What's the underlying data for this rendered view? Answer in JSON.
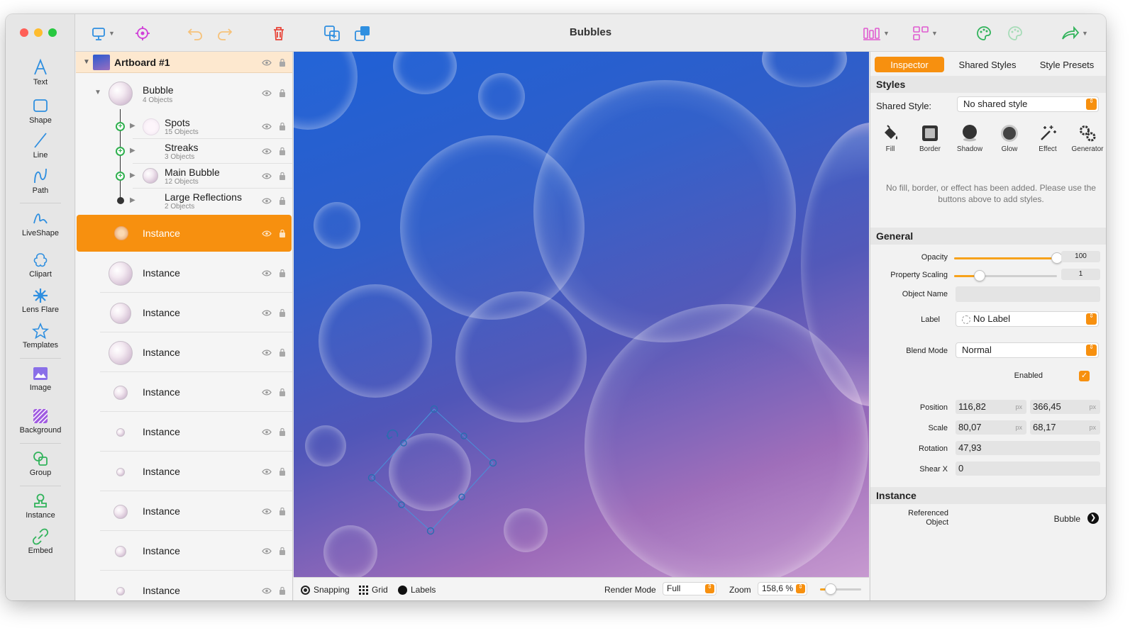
{
  "window": {
    "title": "Bubbles"
  },
  "colors": {
    "accent": "#f7900f",
    "selection": "#4a90d9"
  },
  "tools": [
    {
      "label": "Text",
      "icon": "text-tool-icon"
    },
    {
      "label": "Shape",
      "icon": "shape-tool-icon"
    },
    {
      "label": "Line",
      "icon": "line-tool-icon"
    },
    {
      "label": "Path",
      "icon": "path-tool-icon"
    },
    {
      "label": "LiveShape",
      "icon": "liveshape-tool-icon"
    },
    {
      "label": "Clipart",
      "icon": "clipart-tool-icon"
    },
    {
      "label": "Lens Flare",
      "icon": "lens-flare-tool-icon"
    },
    {
      "label": "Templates",
      "icon": "templates-tool-icon"
    },
    {
      "label": "Image",
      "icon": "image-tool-icon"
    },
    {
      "label": "Background",
      "icon": "background-tool-icon"
    },
    {
      "label": "Group",
      "icon": "group-tool-icon"
    },
    {
      "label": "Instance",
      "icon": "instance-tool-icon"
    },
    {
      "label": "Embed",
      "icon": "embed-tool-icon"
    }
  ],
  "layers": {
    "artboard": "Artboard #1",
    "bubble": {
      "name": "Bubble",
      "count": "4 Objects"
    },
    "children": [
      {
        "name": "Spots",
        "count": "15 Objects"
      },
      {
        "name": "Streaks",
        "count": "3 Objects"
      },
      {
        "name": "Main Bubble",
        "count": "12 Objects"
      },
      {
        "name": "Large Reflections",
        "count": "2 Objects"
      }
    ],
    "instances": [
      "Instance",
      "Instance",
      "Instance",
      "Instance",
      "Instance",
      "Instance",
      "Instance",
      "Instance",
      "Instance",
      "Instance"
    ]
  },
  "status": {
    "snapping": "Snapping",
    "grid": "Grid",
    "labels": "Labels",
    "render_mode_label": "Render Mode",
    "render_mode": "Full",
    "zoom_label": "Zoom",
    "zoom": "158,6 %",
    "zoom_slider_fraction": 0.25
  },
  "inspector": {
    "tabs": [
      "Inspector",
      "Shared Styles",
      "Style Presets"
    ],
    "styles_title": "Styles",
    "shared_style_label": "Shared Style:",
    "shared_style": "No shared style",
    "style_buttons": [
      "Fill",
      "Border",
      "Shadow",
      "Glow",
      "Effect",
      "Generator"
    ],
    "empty_message": "No fill, border, or effect has been added. Please use the buttons above to add styles.",
    "general_title": "General",
    "opacity_label": "Opacity",
    "opacity": "100",
    "opacity_fraction": 1.0,
    "property_scaling_label": "Property Scaling",
    "property_scaling": "1",
    "property_scaling_fraction": 0.25,
    "object_name_label": "Object Name",
    "object_name": "",
    "label_label": "Label",
    "label_value": "No Label",
    "blend_mode_label": "Blend Mode",
    "blend_mode": "Normal",
    "enabled_label": "Enabled",
    "enabled": true,
    "position_label": "Position",
    "position_x": "116,82",
    "position_y": "366,45",
    "scale_label": "Scale",
    "scale_x": "80,07",
    "scale_y": "68,17",
    "unit": "px",
    "rotation_label": "Rotation",
    "rotation": "47,93",
    "shear_label": "Shear X",
    "shear": "0",
    "instance_title": "Instance",
    "referenced_object_label": "Referenced Object",
    "referenced_object": "Bubble"
  }
}
